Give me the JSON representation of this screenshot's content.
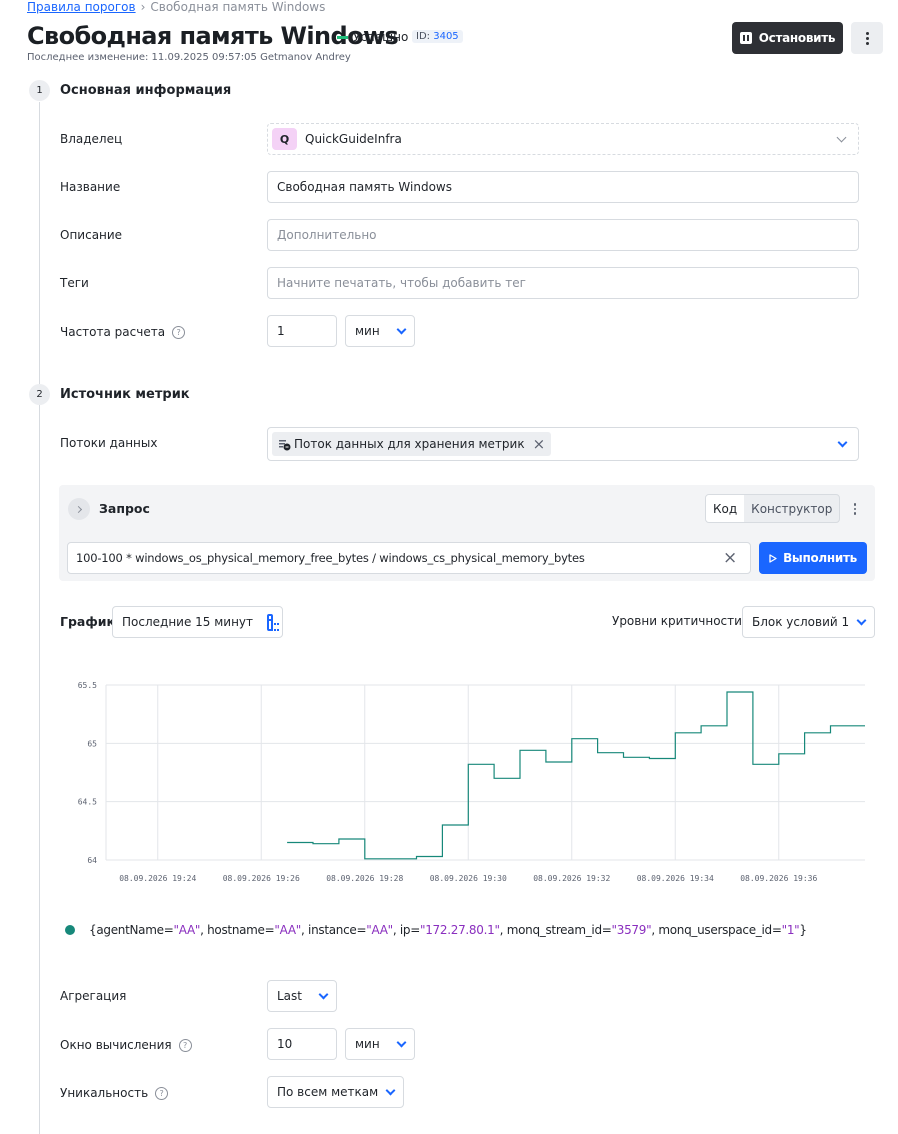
{
  "breadcrumb": {
    "parent": "Правила порогов",
    "current": "Свободная память Windows"
  },
  "header": {
    "title": "Свободная память Windows",
    "status": "Успешно",
    "id_label": "ID:",
    "id_value": "3405",
    "last_modified": "Последнее изменение: 11.09.2025 09:57:05 Getmanov Andrey",
    "stop_button": "Остановить"
  },
  "section1": {
    "number": "1",
    "title": "Основная информация",
    "owner": {
      "label": "Владелец",
      "badge": "Q",
      "value": "QuickGuideInfra"
    },
    "name": {
      "label": "Название",
      "value": "Свободная память Windows"
    },
    "description": {
      "label": "Описание",
      "placeholder": "Дополнительно"
    },
    "tags": {
      "label": "Теги",
      "placeholder": "Начните печатать, чтобы добавить тег"
    },
    "frequency": {
      "label": "Частота расчета",
      "value": "1",
      "unit": "мин"
    }
  },
  "section2": {
    "number": "2",
    "title": "Источник метрик",
    "streams": {
      "label": "Потоки данных",
      "chip": "Поток данных для хранения метрик"
    },
    "query": {
      "title": "Запрос",
      "mode_code": "Код",
      "mode_builder": "Конструктор",
      "expression": "100-100 * windows_os_physical_memory_free_bytes / windows_cs_physical_memory_bytes",
      "run_button": "Выполнить"
    },
    "graph": {
      "label": "График",
      "range": "Последние 15 минут",
      "severity_label": "Уровни критичности",
      "severity_value": "Блок условий 1"
    },
    "legend": {
      "k1": "agentName",
      "v1": "\"AA\"",
      "k2": "hostname",
      "v2": "\"AA\"",
      "k3": "instance",
      "v3": "\"AA\"",
      "k4": "ip",
      "v4": "\"172.27.80.1\"",
      "k5": "monq_stream_id",
      "v5": "\"3579\"",
      "k6": "monq_userspace_id",
      "v6": "\"1\""
    },
    "aggregation": {
      "label": "Агрегация",
      "value": "Last"
    },
    "window": {
      "label": "Окно вычисления",
      "value": "10",
      "unit": "мин"
    },
    "uniqueness": {
      "label": "Уникальность",
      "value": "По всем меткам"
    }
  },
  "colors": {
    "accent": "#1a66ff",
    "success": "#1fbd7a",
    "series": "#17887a",
    "label_value": "#8a2fbf"
  },
  "chart_data": {
    "type": "line",
    "step": true,
    "y_ticks": [
      "65.5",
      "65",
      "64.5",
      "64"
    ],
    "ylim": [
      64,
      65.5
    ],
    "x_ticks": [
      "08.09.2026 19:24",
      "08.09.2026 19:26",
      "08.09.2026 19:28",
      "08.09.2026 19:30",
      "08.09.2026 19:32",
      "08.09.2026 19:34",
      "08.09.2026 19:36"
    ],
    "series": [
      {
        "x": [
          "19:26:30",
          "19:27:00",
          "19:27:30",
          "19:28:00",
          "19:28:30",
          "19:29:00",
          "19:29:30",
          "19:30:00",
          "19:30:30",
          "19:31:00",
          "19:31:30",
          "19:32:00",
          "19:32:30",
          "19:33:00",
          "19:33:30",
          "19:34:00",
          "19:34:30",
          "19:35:00",
          "19:35:30",
          "19:36:00",
          "19:36:30",
          "19:37:00",
          "19:37:40"
        ],
        "y": [
          64.15,
          64.14,
          64.18,
          64.01,
          64.01,
          64.03,
          64.3,
          64.82,
          64.7,
          64.94,
          64.84,
          65.04,
          64.92,
          64.88,
          64.87,
          65.09,
          65.15,
          65.44,
          64.82,
          64.91,
          65.09,
          65.15,
          65.15
        ]
      }
    ]
  }
}
